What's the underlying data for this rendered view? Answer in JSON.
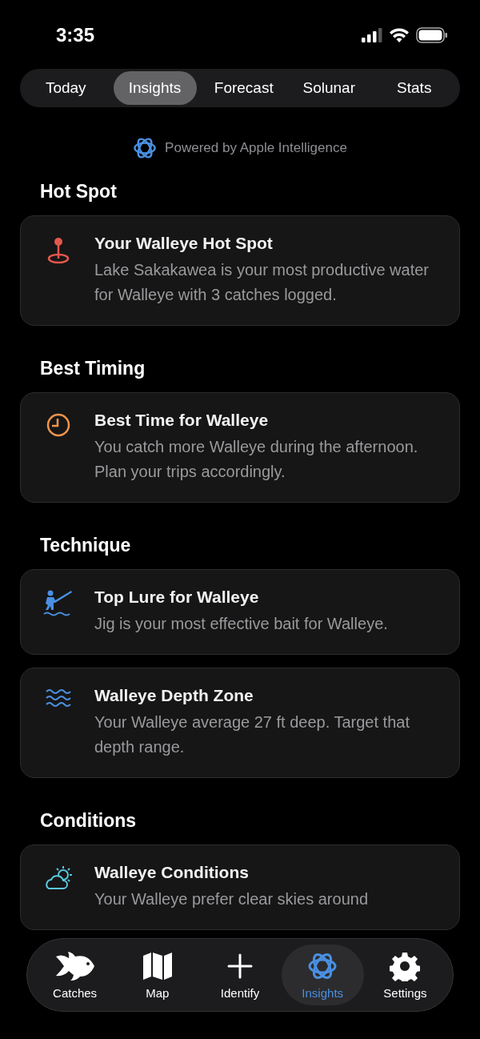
{
  "status_bar": {
    "time": "3:35"
  },
  "tabs": [
    {
      "label": "Today",
      "selected": false
    },
    {
      "label": "Insights",
      "selected": true
    },
    {
      "label": "Forecast",
      "selected": false
    },
    {
      "label": "Solunar",
      "selected": false
    },
    {
      "label": "Stats",
      "selected": false
    }
  ],
  "powered_by": "Powered by Apple Intelligence",
  "sections": [
    {
      "title": "Hot Spot",
      "cards": [
        {
          "title": "Your Walleye Hot Spot",
          "body": "Lake Sakakawea is your most productive water for Walleye with 3 catches logged.",
          "color": "#e5574c"
        }
      ]
    },
    {
      "title": "Best Timing",
      "cards": [
        {
          "title": "Best Time for Walleye",
          "body": "You catch more Walleye during the afternoon. Plan your trips accordingly.",
          "color": "#f0954a"
        }
      ]
    },
    {
      "title": "Technique",
      "cards": [
        {
          "title": "Top Lure for Walleye",
          "body": "Jig is your most effective bait for Walleye.",
          "color": "#4a90e2"
        },
        {
          "title": "Walleye Depth Zone",
          "body": "Your Walleye average 27 ft deep. Target that depth range.",
          "color": "#4a90e2"
        }
      ]
    },
    {
      "title": "Conditions",
      "cards": [
        {
          "title": "Walleye Conditions",
          "body": "Your Walleye prefer clear skies around",
          "color": "#5ac8e0"
        }
      ]
    }
  ],
  "tab_bar": [
    {
      "label": "Catches",
      "selected": false
    },
    {
      "label": "Map",
      "selected": false
    },
    {
      "label": "Identify",
      "selected": false
    },
    {
      "label": "Insights",
      "selected": true
    },
    {
      "label": "Settings",
      "selected": false
    }
  ]
}
